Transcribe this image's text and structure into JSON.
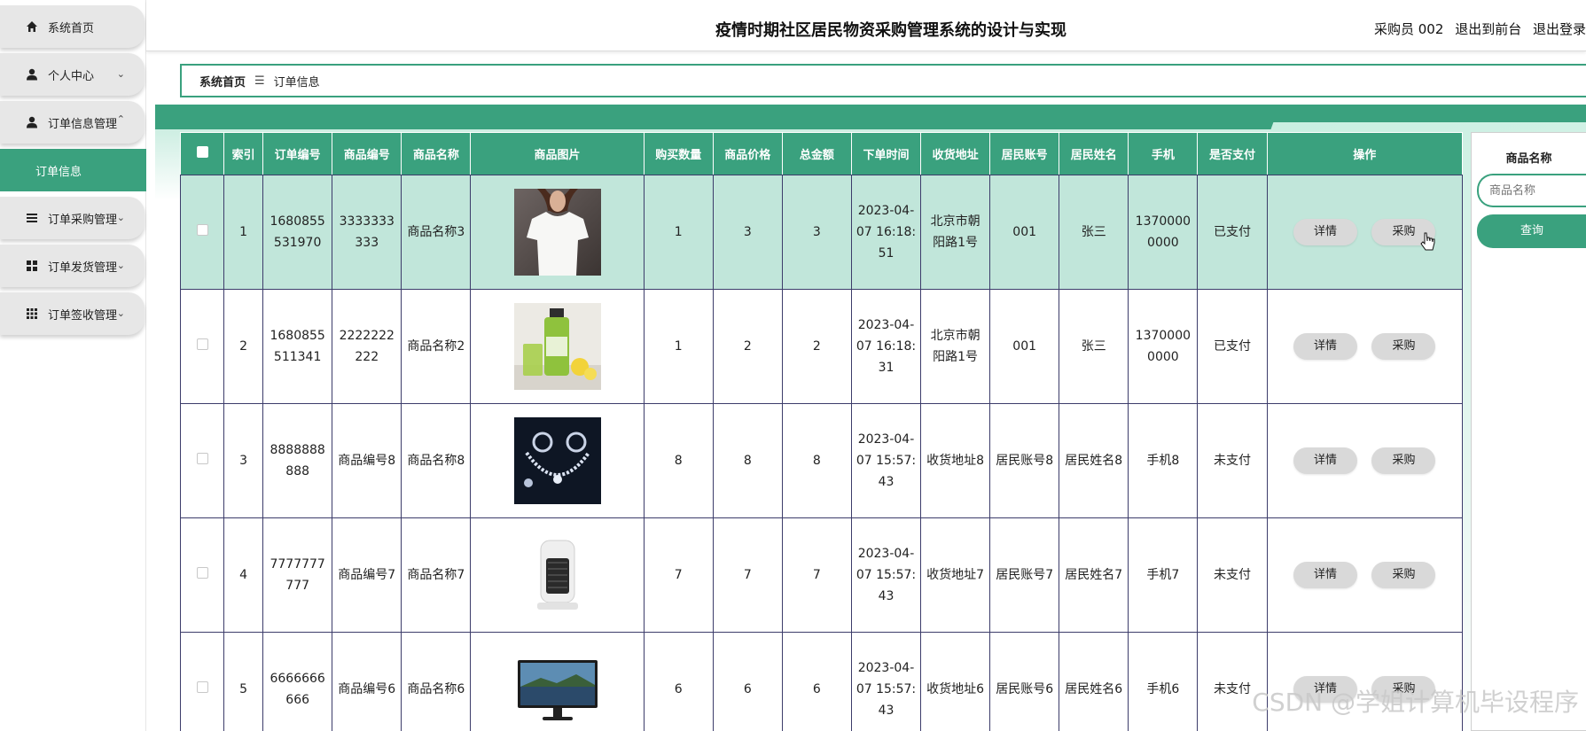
{
  "sidebar": {
    "items": [
      {
        "label": "系统首页",
        "icon": "home-icon"
      },
      {
        "label": "个人中心",
        "icon": "user-icon"
      },
      {
        "label": "订单信息管理",
        "icon": "user-icon"
      },
      {
        "label": "订单信息"
      },
      {
        "label": "订单采购管理",
        "icon": "list-icon"
      },
      {
        "label": "订单发货管理",
        "icon": "grid-icon"
      },
      {
        "label": "订单签收管理",
        "icon": "grid9-icon"
      }
    ]
  },
  "header": {
    "title": "疫情时期社区居民物资采购管理系统的设计与实现",
    "user": "采购员 002",
    "exit_front": "退出到前台",
    "logout": "退出登录"
  },
  "breadcrumb": {
    "home": "系统首页",
    "sep": "☰",
    "current": "订单信息"
  },
  "table": {
    "columns": [
      "索引",
      "订单编号",
      "商品编号",
      "商品名称",
      "商品图片",
      "购买数量",
      "商品价格",
      "总金额",
      "下单时间",
      "收货地址",
      "居民账号",
      "居民姓名",
      "手机",
      "是否支付",
      "操作"
    ],
    "rows": [
      {
        "idx": "1",
        "order_no": "1680855531970",
        "goods_no": "3333333333",
        "goods_name": "商品名称3",
        "image": "white-tshirt",
        "qty": "1",
        "price": "3",
        "total": "3",
        "time": "2023-04-07 16:18:51",
        "address": "北京市朝阳路1号",
        "account": "001",
        "name": "张三",
        "phone": "13700000000",
        "paid": "已支付"
      },
      {
        "idx": "2",
        "order_no": "1680855511341",
        "goods_no": "2222222222",
        "goods_name": "商品名称2",
        "image": "green-juice",
        "qty": "1",
        "price": "2",
        "total": "2",
        "time": "2023-04-07 16:18:31",
        "address": "北京市朝阳路1号",
        "account": "001",
        "name": "张三",
        "phone": "13700000000",
        "paid": "已支付"
      },
      {
        "idx": "3",
        "order_no": "8888888888",
        "goods_no": "商品编号8",
        "goods_name": "商品名称8",
        "image": "jewelry-set",
        "qty": "8",
        "price": "8",
        "total": "8",
        "time": "2023-04-07 15:57:43",
        "address": "收货地址8",
        "account": "居民账号8",
        "name": "居民姓名8",
        "phone": "手机8",
        "paid": "未支付"
      },
      {
        "idx": "4",
        "order_no": "7777777777",
        "goods_no": "商品编号7",
        "goods_name": "商品名称7",
        "image": "space-heater",
        "qty": "7",
        "price": "7",
        "total": "7",
        "time": "2023-04-07 15:57:43",
        "address": "收货地址7",
        "account": "居民账号7",
        "name": "居民姓名7",
        "phone": "手机7",
        "paid": "未支付"
      },
      {
        "idx": "5",
        "order_no": "6666666666",
        "goods_no": "商品编号6",
        "goods_name": "商品名称6",
        "image": "monitor",
        "qty": "6",
        "price": "6",
        "total": "6",
        "time": "2023-04-07 15:57:43",
        "address": "收货地址6",
        "account": "居民账号6",
        "name": "居民姓名6",
        "phone": "手机6",
        "paid": "未支付"
      }
    ],
    "detail_label": "详情",
    "purchase_label": "采购"
  },
  "search": {
    "label": "商品名称",
    "placeholder": "商品名称",
    "button": "查询"
  },
  "watermark": "CSDN @学姐计算机毕设程序",
  "colors": {
    "accent": "#3aa17e",
    "highlight_row": "#c1e6da",
    "button_gray": "#d9d9d9"
  }
}
